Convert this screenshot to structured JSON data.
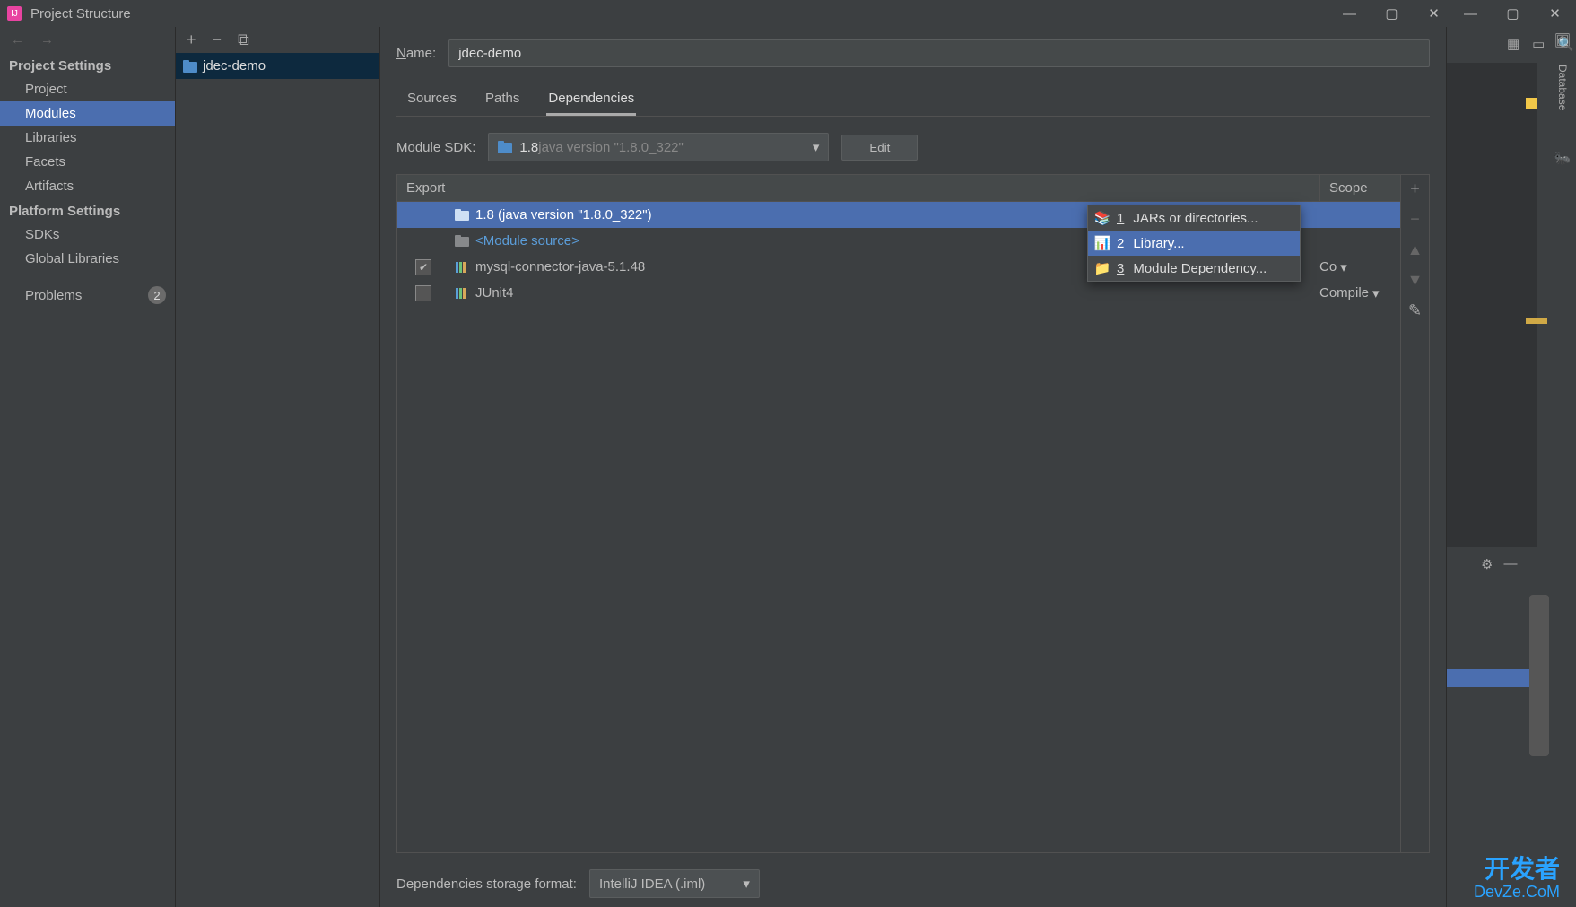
{
  "window": {
    "title": "Project Structure"
  },
  "nav": {
    "section1": "Project Settings",
    "items1": [
      "Project",
      "Modules",
      "Libraries",
      "Facets",
      "Artifacts"
    ],
    "section2": "Platform Settings",
    "items2": [
      "SDKs",
      "Global Libraries"
    ],
    "problems": "Problems",
    "problem_count": "2"
  },
  "modules": {
    "selected": "jdec-demo"
  },
  "detail": {
    "name_label": "Name:",
    "name_value": "jdec-demo",
    "tabs": [
      "Sources",
      "Paths",
      "Dependencies"
    ],
    "sdk_label_pre": "M",
    "sdk_label_rest": "odule SDK:",
    "sdk_value_bold": "1.8",
    "sdk_value_rest": " java version \"1.8.0_322\"",
    "edit_btn_pre": "E",
    "edit_btn_rest": "dit",
    "header_export": "Export",
    "header_scope": "Scope",
    "rows": [
      {
        "text": "1.8 (java version \"1.8.0_322\")",
        "checkbox": false,
        "icon": "folder",
        "selected": true,
        "link": false,
        "scope": ""
      },
      {
        "text": "<Module source>",
        "checkbox": false,
        "icon": "folder",
        "selected": false,
        "link": true,
        "scope": ""
      },
      {
        "text": "mysql-connector-java-5.1.48",
        "checkbox": true,
        "checked": true,
        "icon": "lib",
        "selected": false,
        "link": false,
        "scope": "Co"
      },
      {
        "text": "JUnit4",
        "checkbox": true,
        "checked": false,
        "icon": "lib",
        "selected": false,
        "link": false,
        "scope": "Compile"
      }
    ],
    "storage_label": "Dependencies storage format:",
    "storage_value": "IntelliJ IDEA (.iml)"
  },
  "popup": {
    "items": [
      {
        "num": "1",
        "label": "JARs or directories..."
      },
      {
        "num": "2",
        "label": "Library..."
      },
      {
        "num": "3",
        "label": "Module Dependency..."
      }
    ]
  },
  "sidebar": {
    "database": "Database"
  },
  "watermark": {
    "l1": "开发者",
    "l2": "DevZe.CoM"
  }
}
